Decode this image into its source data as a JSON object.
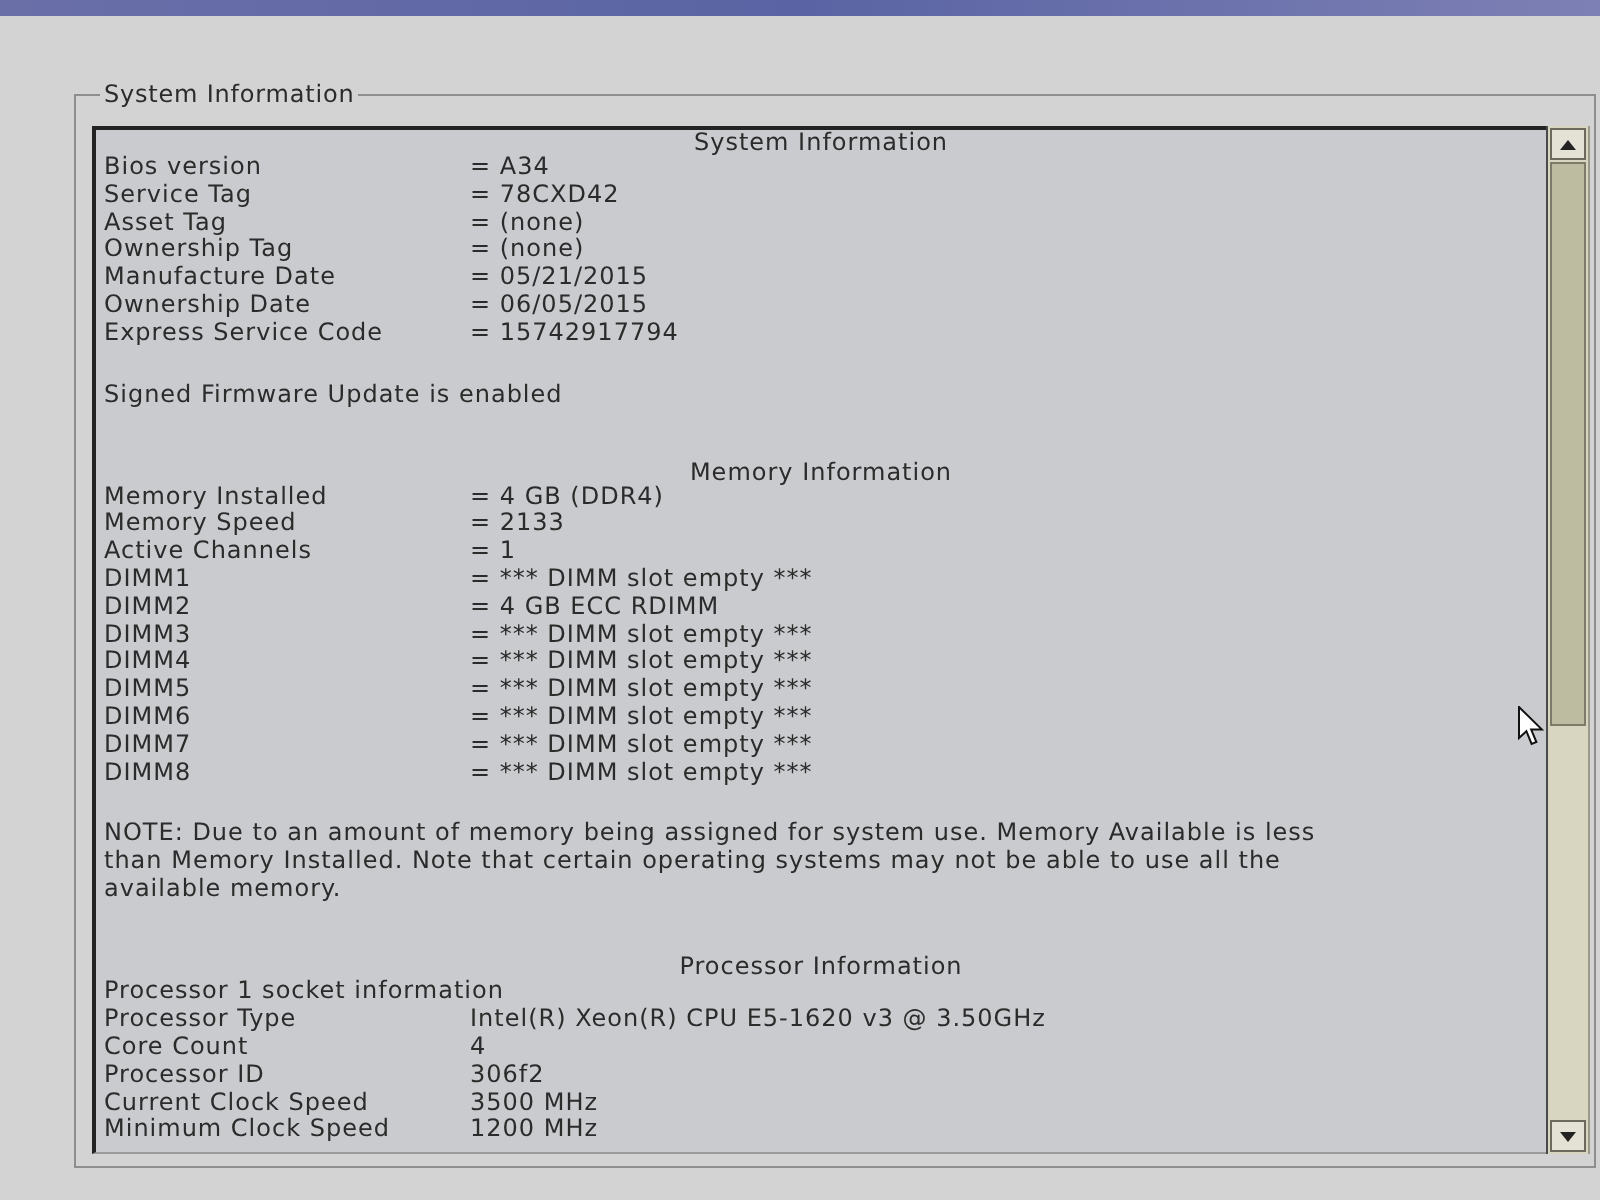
{
  "group_box": {
    "title": "System Information"
  },
  "sections": [
    {
      "heading": "System Information",
      "rows": [
        {
          "kind": "field",
          "label": "Bios version",
          "value": "= A34"
        },
        {
          "kind": "field",
          "label": "Service Tag",
          "value": "= 78CXD42"
        },
        {
          "kind": "field",
          "label": "Asset Tag",
          "value": "= (none)"
        },
        {
          "kind": "field",
          "label": "Ownership Tag",
          "value": "= (none)"
        },
        {
          "kind": "field",
          "label": "Manufacture Date",
          "value": "= 05/21/2015"
        },
        {
          "kind": "field",
          "label": "Ownership Date",
          "value": "= 06/05/2015"
        },
        {
          "kind": "field",
          "label": "Express Service Code",
          "value": "= 15742917794"
        }
      ],
      "note": "Signed Firmware Update is enabled"
    },
    {
      "heading": "Memory Information",
      "rows": [
        {
          "kind": "field",
          "label": "Memory Installed",
          "value": "= 4 GB (DDR4)"
        },
        {
          "kind": "field",
          "label": "Memory Speed",
          "value": "= 2133"
        },
        {
          "kind": "field",
          "label": "Active Channels",
          "value": "= 1"
        },
        {
          "kind": "field",
          "label": "DIMM1",
          "value": "= *** DIMM slot empty ***"
        },
        {
          "kind": "field",
          "label": "DIMM2",
          "value": "= 4 GB ECC RDIMM"
        },
        {
          "kind": "field",
          "label": "DIMM3",
          "value": "= *** DIMM slot empty ***"
        },
        {
          "kind": "field",
          "label": "DIMM4",
          "value": "= *** DIMM slot empty ***"
        },
        {
          "kind": "field",
          "label": "DIMM5",
          "value": "= *** DIMM slot empty ***"
        },
        {
          "kind": "field",
          "label": "DIMM6",
          "value": "= *** DIMM slot empty ***"
        },
        {
          "kind": "field",
          "label": "DIMM7",
          "value": "= *** DIMM slot empty ***"
        },
        {
          "kind": "field",
          "label": "DIMM8",
          "value": "= *** DIMM slot empty ***"
        }
      ],
      "note": "NOTE: Due to an amount of memory being assigned for system use. Memory Available is less than Memory Installed. Note that certain operating systems may not be able to use all the available memory."
    },
    {
      "heading": "Processor Information",
      "rows": [
        {
          "kind": "subheading",
          "label": "Processor 1 socket information"
        },
        {
          "kind": "field",
          "label": "Processor Type",
          "value": "Intel(R) Xeon(R) CPU E5-1620 v3 @ 3.50GHz"
        },
        {
          "kind": "field",
          "label": "Core Count",
          "value": "4"
        },
        {
          "kind": "field",
          "label": "Processor ID",
          "value": "306f2"
        },
        {
          "kind": "field",
          "label": "Current Clock Speed",
          "value": "3500 MHz"
        },
        {
          "kind": "field",
          "label": "Minimum Clock Speed",
          "value": "1200 MHz"
        }
      ]
    }
  ]
}
